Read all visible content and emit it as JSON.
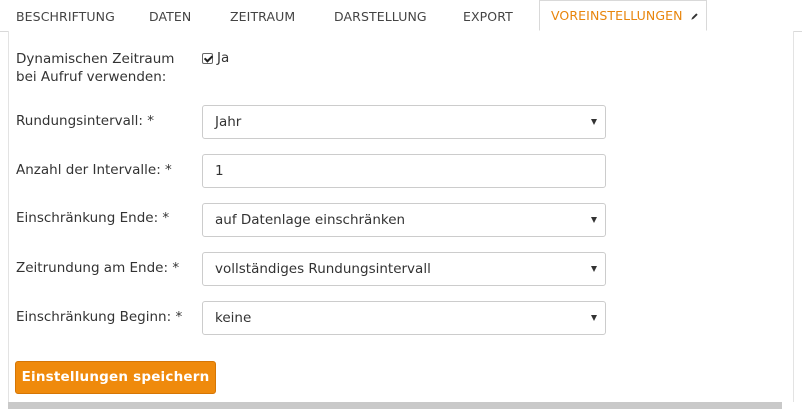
{
  "tabs": [
    {
      "label": "BESCHRIFTUNG"
    },
    {
      "label": "DATEN"
    },
    {
      "label": "ZEITRAUM"
    },
    {
      "label": "DARSTELLUNG"
    },
    {
      "label": "EXPORT"
    },
    {
      "label": "VOREINSTELLUNGEN",
      "active": true
    }
  ],
  "form": {
    "dynamic": {
      "label": "Dynamischen Zeitraum bei Aufruf verwenden:",
      "checkbox_label": "Ja",
      "checked": true
    },
    "rounding_interval": {
      "label": "Rundungsintervall: *",
      "value": "Jahr"
    },
    "interval_count": {
      "label": "Anzahl der Intervalle: *",
      "value": "1"
    },
    "end_limit": {
      "label": "Einschränkung Ende: *",
      "value": "auf Datenlage einschränken"
    },
    "end_rounding": {
      "label": "Zeitrundung am Ende: *",
      "value": "vollständiges Rundungsintervall"
    },
    "start_limit": {
      "label": "Einschränkung Beginn: *",
      "value": "keine"
    }
  },
  "save_button": {
    "label": "Einstellungen speichern"
  },
  "colors": {
    "accent": "#e8850c",
    "button": "#ef8a0c"
  }
}
